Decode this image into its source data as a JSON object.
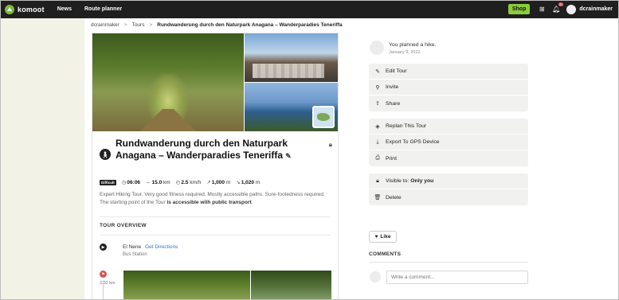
{
  "nav": {
    "logo_text": "komoot",
    "links": [
      "News",
      "Route planner"
    ],
    "shop_label": "Shop",
    "notification_count": "21",
    "user_name": "dcrainmaker",
    "accent_color": "#8ccb3c"
  },
  "breadcrumb": {
    "items": [
      "dcrainmaker",
      "Tours",
      "Rundwanderung durch den Naturpark Anagana – Wanderparadies Teneriffa"
    ],
    "separator": ">"
  },
  "tour": {
    "title": "Rundwanderung durch den Naturpark Anagana – Wanderparadies Teneriffa",
    "difficulty": "Difficult",
    "duration": "06:06",
    "distance_value": "15.0",
    "distance_unit": "km",
    "speed_value": "2.5",
    "speed_unit": "km/h",
    "uphill_value": "1,000",
    "uphill_unit": "m",
    "downhill_value": "1,020",
    "downhill_unit": "m",
    "description_plain": "Expert Hiking Tour. Very good fitness required. Mostly accessible paths. Sure-footedness required. The starting point of the Tour ",
    "description_bold": "is accessible with public transport",
    "description_end": ".",
    "overview_title": "TOUR OVERVIEW",
    "waypoints": [
      {
        "name": "El Nene",
        "link": "Get Directions",
        "sub": "Bus Station"
      },
      {
        "distance": "3.32 km"
      }
    ]
  },
  "activity": {
    "text": "You planned a hike.",
    "date": "January 9, 2022"
  },
  "menu": {
    "group1": [
      {
        "icon": "pencil-icon",
        "label": "Edit Tour"
      },
      {
        "icon": "invite-icon",
        "label": "Invite"
      },
      {
        "icon": "share-icon",
        "label": "Share"
      }
    ],
    "group2": [
      {
        "icon": "replan-icon",
        "label": "Replan This Tour"
      },
      {
        "icon": "export-icon",
        "label": "Export To GPS Device"
      },
      {
        "icon": "print-icon",
        "label": "Print"
      }
    ],
    "visibility_label": "Visible to:",
    "visibility_value": "Only you",
    "delete_label": "Delete"
  },
  "social": {
    "like_label": "Like",
    "comments_title": "COMMENTS",
    "comment_placeholder": "Write a comment..."
  }
}
